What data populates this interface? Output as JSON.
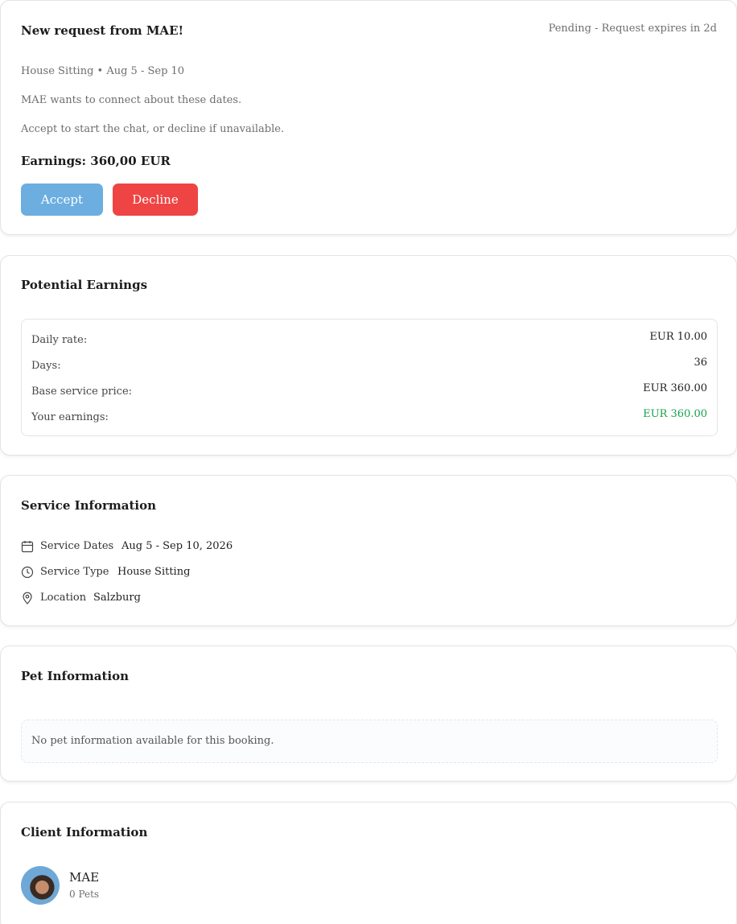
{
  "request": {
    "title": "New request from MAE!",
    "status": "Pending - Request expires in 2d",
    "summary": "House Sitting • Aug 5 - Sep 10",
    "message1": "MAE wants to connect about these dates.",
    "message2": "Accept to start the chat, or decline if unavailable.",
    "earnings": "Earnings: 360,00 EUR",
    "accept_label": "Accept",
    "decline_label": "Decline"
  },
  "earnings": {
    "title": "Potential Earnings",
    "rows": [
      {
        "label": "Daily rate:",
        "value": "EUR 10.00"
      },
      {
        "label": "Days:",
        "value": "36"
      },
      {
        "label": "Base service price:",
        "value": "EUR 360.00"
      },
      {
        "label": "Your earnings:",
        "value": "EUR 360.00"
      }
    ],
    "highlight_color": "#17a34a"
  },
  "service": {
    "title": "Service Information",
    "rows": [
      {
        "icon": "calendar-icon",
        "label": "Service Dates",
        "value": "Aug 5 - Sep 10, 2026"
      },
      {
        "icon": "clock-icon",
        "label": "Service Type",
        "value": "House Sitting"
      },
      {
        "icon": "location-pin-icon",
        "label": "Location",
        "value": "Salzburg"
      }
    ]
  },
  "pets": {
    "title": "Pet Information",
    "empty_message": "No pet information available for this booking."
  },
  "client": {
    "title": "Client Information",
    "name": "MAE",
    "pets": "0 Pets"
  },
  "colors": {
    "accept": "#6caee0",
    "decline": "#ef4444"
  }
}
